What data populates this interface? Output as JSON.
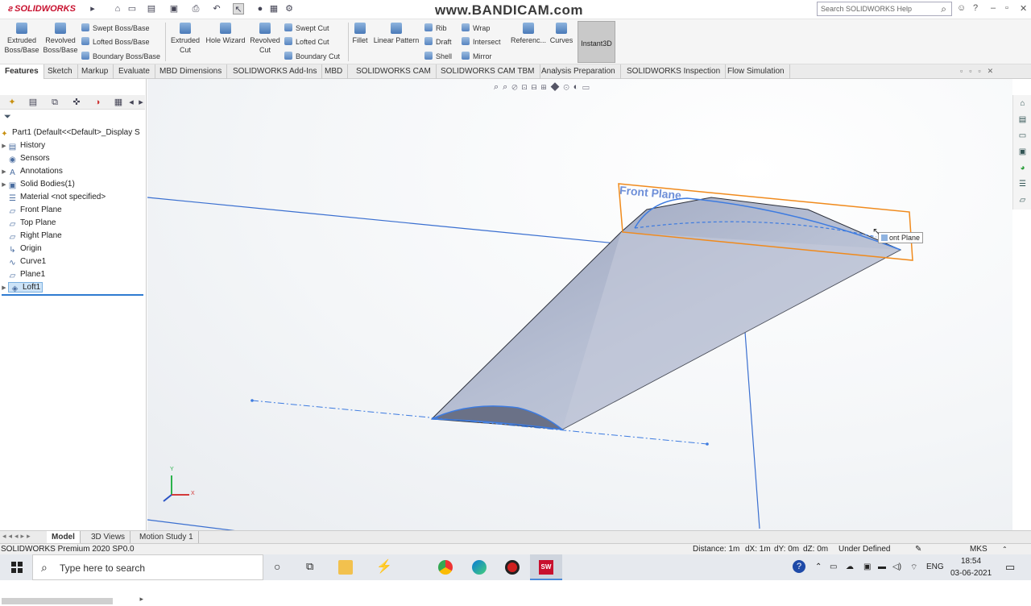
{
  "app": {
    "logo_text": "SOLIDWORKS",
    "watermark": "www.BANDICAM.com",
    "search_placeholder": "Search SOLIDWORKS Help"
  },
  "toolbar": {
    "extruded_boss": "Extruded Boss/Base",
    "revolved_boss": "Revolved Boss/Base",
    "swept_boss": "Swept Boss/Base",
    "lofted_boss": "Lofted Boss/Base",
    "boundary_boss": "Boundary Boss/Base",
    "extruded_cut": "Extruded Cut",
    "hole_wizard": "Hole Wizard",
    "revolved_cut": "Revolved Cut",
    "swept_cut": "Swept Cut",
    "lofted_cut": "Lofted Cut",
    "boundary_cut": "Boundary Cut",
    "fillet": "Fillet",
    "linear_pattern": "Linear Pattern",
    "rib": "Rib",
    "draft": "Draft",
    "shell": "Shell",
    "wrap": "Wrap",
    "intersect": "Intersect",
    "mirror": "Mirror",
    "reference": "Referenc...",
    "curves": "Curves",
    "instant3d": "Instant3D"
  },
  "tabs": [
    "Features",
    "Sketch",
    "Markup",
    "Evaluate",
    "MBD Dimensions",
    "SOLIDWORKS Add-Ins",
    "MBD",
    "SOLIDWORKS CAM",
    "SOLIDWORKS CAM TBM",
    "Analysis Preparation",
    "SOLIDWORKS Inspection",
    "Flow Simulation"
  ],
  "tree": {
    "part": "Part1  (Default<<Default>_Display S",
    "items": [
      "History",
      "Sensors",
      "Annotations",
      "Solid Bodies(1)",
      "Material <not specified>",
      "Front Plane",
      "Top Plane",
      "Right Plane",
      "Origin",
      "Curve1",
      "Plane1",
      "Loft1"
    ]
  },
  "viewport": {
    "plane_label": "Front Plane",
    "tooltip": "ont Plane"
  },
  "bottom_tabs": [
    "Model",
    "3D Views",
    "Motion Study 1"
  ],
  "status": {
    "version": "SOLIDWORKS Premium 2020 SP0.0",
    "distance": "Distance: 1m",
    "dx": "dX: 1m",
    "dy": "dY: 0m",
    "dz": "dZ: 0m",
    "state": "Under Defined",
    "units": "MKS"
  },
  "taskbar": {
    "search_text": "Type here to search",
    "lang": "ENG",
    "time": "18:54",
    "date": "03-06-2021"
  }
}
